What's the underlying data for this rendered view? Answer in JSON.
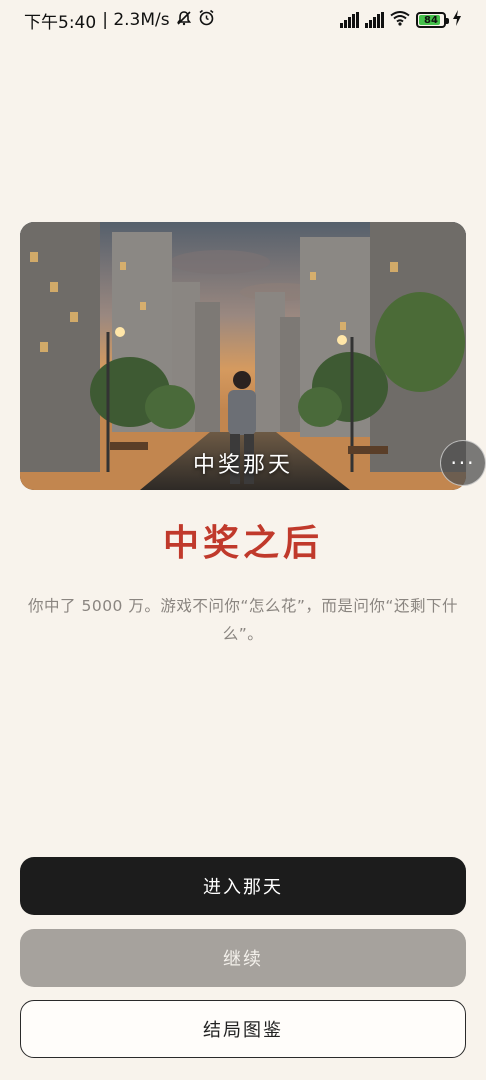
{
  "status_bar": {
    "time": "下午5:40",
    "speed": "| 2.3M/s",
    "battery": "84"
  },
  "hero": {
    "caption": "中奖那天"
  },
  "title": "中奖之后",
  "description": "你中了 5000 万。游戏不问你“怎么花”，而是问你“还剩下什么”。",
  "buttons": {
    "enter": "进入那天",
    "continue": "继续",
    "endings": "结局图鉴"
  },
  "more_button_label": "···",
  "colors": {
    "background": "#f8f3ec",
    "title": "#c0392b",
    "primary_button": "#1c1c1c",
    "disabled_button": "#a6a29d"
  }
}
